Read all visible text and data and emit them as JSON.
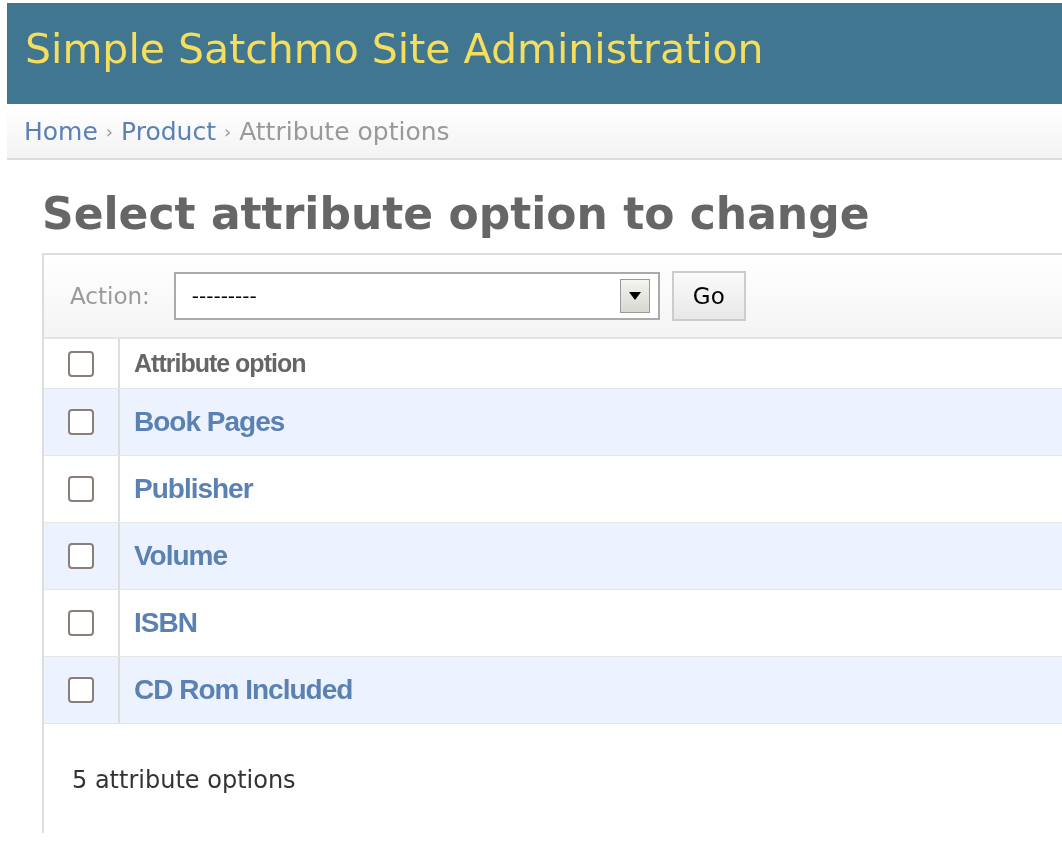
{
  "header": {
    "title": "Simple Satchmo Site Administration"
  },
  "breadcrumbs": [
    {
      "label": "Home",
      "kind": "link"
    },
    {
      "label": "›",
      "kind": "separator"
    },
    {
      "label": "Product",
      "kind": "link"
    },
    {
      "label": "›",
      "kind": "separator"
    },
    {
      "label": "Attribute options",
      "kind": "current"
    }
  ],
  "heading": "Select attribute option to change",
  "actions": {
    "label": "Action:",
    "value": "---------",
    "button": "Go"
  },
  "table": {
    "select_all_checked": false,
    "columns": [
      "Attribute option"
    ],
    "rows": [
      {
        "name": "Book Pages",
        "checked": false
      },
      {
        "name": "Publisher",
        "checked": false
      },
      {
        "name": "Volume",
        "checked": false
      },
      {
        "name": "ISBN",
        "checked": false
      },
      {
        "name": "CD Rom Included",
        "checked": false
      }
    ]
  },
  "result_count": "5 attribute options"
}
